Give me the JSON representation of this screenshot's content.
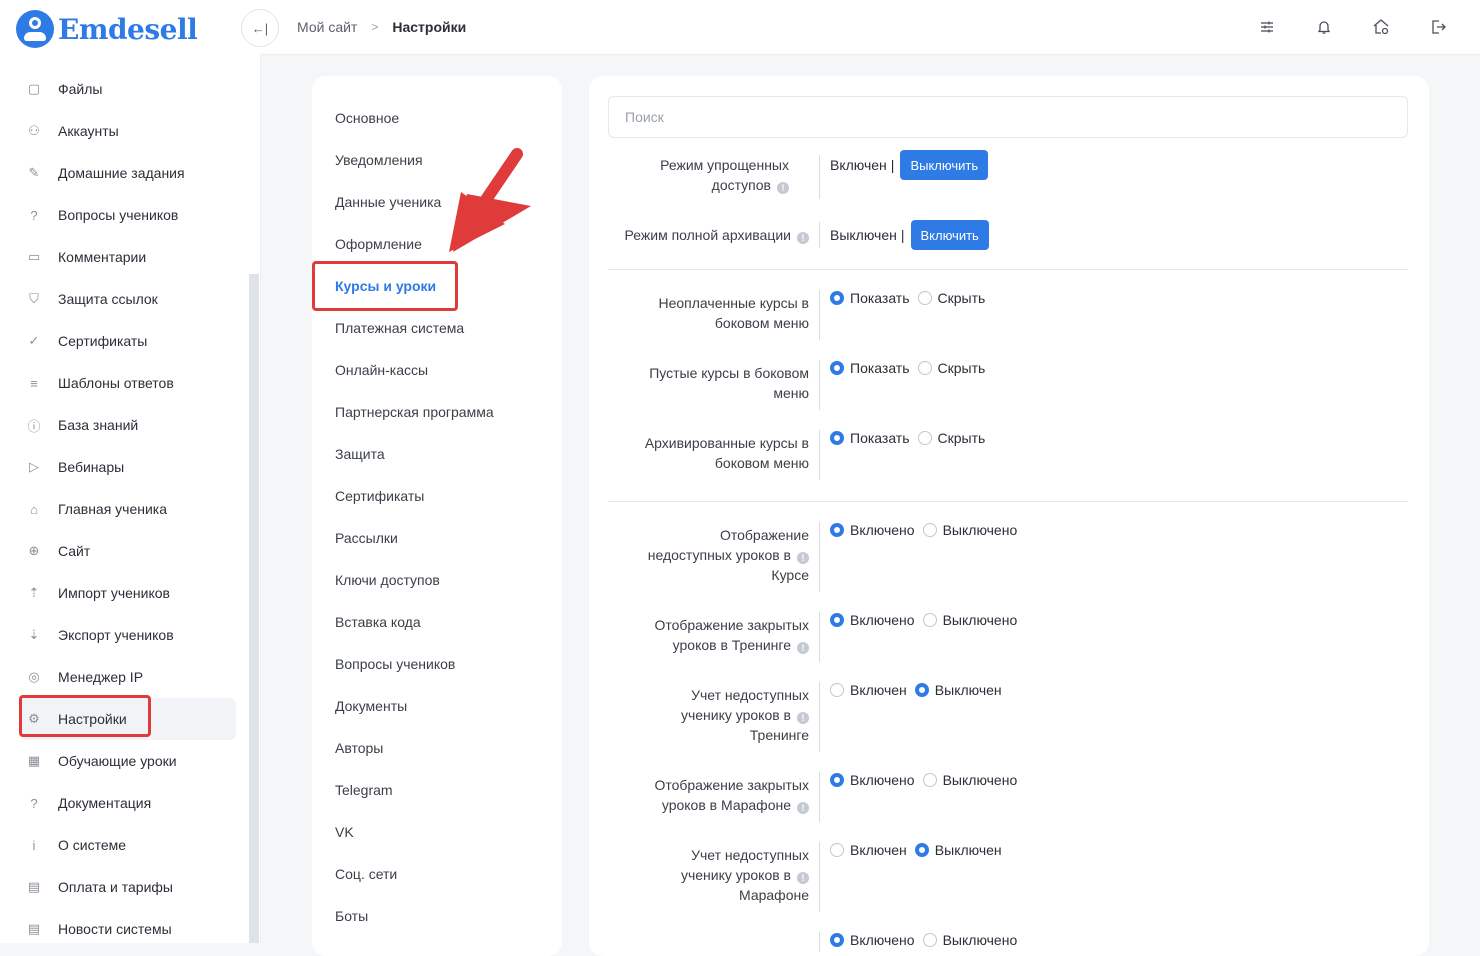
{
  "app": {
    "logo_text": "Emdesell"
  },
  "colors": {
    "accent": "#2e7be6",
    "highlight": "#e03b3b"
  },
  "sidebar": {
    "items": [
      {
        "label": "Файлы",
        "icon": "file-icon"
      },
      {
        "label": "Аккаунты",
        "icon": "users-icon"
      },
      {
        "label": "Домашние задания",
        "icon": "pencil-icon"
      },
      {
        "label": "Вопросы учеников",
        "icon": "question-circle-icon"
      },
      {
        "label": "Комментарии",
        "icon": "comment-icon"
      },
      {
        "label": "Защита ссылок",
        "icon": "shield-icon"
      },
      {
        "label": "Сертификаты",
        "icon": "check-circle-icon"
      },
      {
        "label": "Шаблоны ответов",
        "icon": "list-icon"
      },
      {
        "label": "База знаний",
        "icon": "info-circle-icon"
      },
      {
        "label": "Вебинары",
        "icon": "play-icon"
      },
      {
        "label": "Главная ученика",
        "icon": "home-icon"
      },
      {
        "label": "Сайт",
        "icon": "globe-icon"
      },
      {
        "label": "Импорт учеников",
        "icon": "upload-icon"
      },
      {
        "label": "Экспорт учеников",
        "icon": "download-icon"
      },
      {
        "label": "Менеджер IP",
        "icon": "target-icon"
      },
      {
        "label": "Настройки",
        "icon": "gear-icon",
        "active": true
      },
      {
        "label": "Обучающие уроки",
        "icon": "film-icon"
      },
      {
        "label": "Документация",
        "icon": "help-square-icon"
      },
      {
        "label": "О системе",
        "icon": "info-square-icon"
      },
      {
        "label": "Оплата и тарифы",
        "icon": "receipt-icon"
      },
      {
        "label": "Новости системы",
        "icon": "news-icon"
      }
    ]
  },
  "header": {
    "breadcrumb": {
      "home": "Мой сайт",
      "separator": ">",
      "current": "Настройки"
    },
    "icons": [
      "sliders-icon",
      "bell-icon",
      "home-gear-icon",
      "logout-icon"
    ]
  },
  "settings_menu": {
    "items": [
      "Основное",
      "Уведомления",
      "Данные ученика",
      "Оформление",
      "Курсы и уроки",
      "Платежная система",
      "Онлайн-кассы",
      "Партнерская программа",
      "Защита",
      "Сертификаты",
      "Рассылки",
      "Ключи доступов",
      "Вставка кода",
      "Вопросы учеников",
      "Документы",
      "Авторы",
      "Telegram",
      "VK",
      "Соц. сети",
      "Боты"
    ],
    "active_index": 4
  },
  "content": {
    "search_placeholder": "Поиск",
    "access_mode": {
      "label_1": "Режим упрощенных",
      "label_2": "доступов",
      "status": "Включен",
      "sep": "|",
      "button": "Выключить"
    },
    "archive_mode": {
      "label": "Режим полной архивации",
      "status": "Выключен",
      "sep": "|",
      "button": "Включить"
    },
    "unpaid_courses": {
      "label_1": "Неоплаченные курсы в",
      "label_2": "боковом меню",
      "opt_a": "Показать",
      "opt_b": "Скрыть",
      "selected": "a"
    },
    "empty_courses": {
      "label_1": "Пустые курсы в боковом",
      "label_2": "меню",
      "opt_a": "Показать",
      "opt_b": "Скрыть",
      "selected": "a"
    },
    "archived_courses": {
      "label_1": "Архивированные курсы в",
      "label_2": "боковом меню",
      "opt_a": "Показать",
      "opt_b": "Скрыть",
      "selected": "a"
    },
    "unavailable_lessons_course": {
      "label_1": "Отображение",
      "label_2": "недоступных уроков в",
      "label_3": "Курсе",
      "opt_a": "Включено",
      "opt_b": "Выключено",
      "selected": "a"
    },
    "closed_lessons_training": {
      "label_1": "Отображение закрытых",
      "label_2": "уроков в Тренинге",
      "opt_a": "Включено",
      "opt_b": "Выключено",
      "selected": "a"
    },
    "count_unavailable_training": {
      "label_1": "Учет недоступных",
      "label_2": "ученику уроков в",
      "label_3": "Тренинге",
      "opt_a": "Включен",
      "opt_b": "Выключен",
      "selected": "b"
    },
    "closed_lessons_marathon": {
      "label_1": "Отображение закрытых",
      "label_2": "уроков в Марафоне",
      "opt_a": "Включено",
      "opt_b": "Выключено",
      "selected": "a"
    },
    "count_unavailable_marathon": {
      "label_1": "Учет недоступных",
      "label_2": "ученику уроков в",
      "label_3": "Марафоне",
      "opt_a": "Включен",
      "opt_b": "Выключен",
      "selected": "b"
    },
    "partial_row": {
      "opt_a": "Включено",
      "opt_b": "Выключено"
    }
  }
}
